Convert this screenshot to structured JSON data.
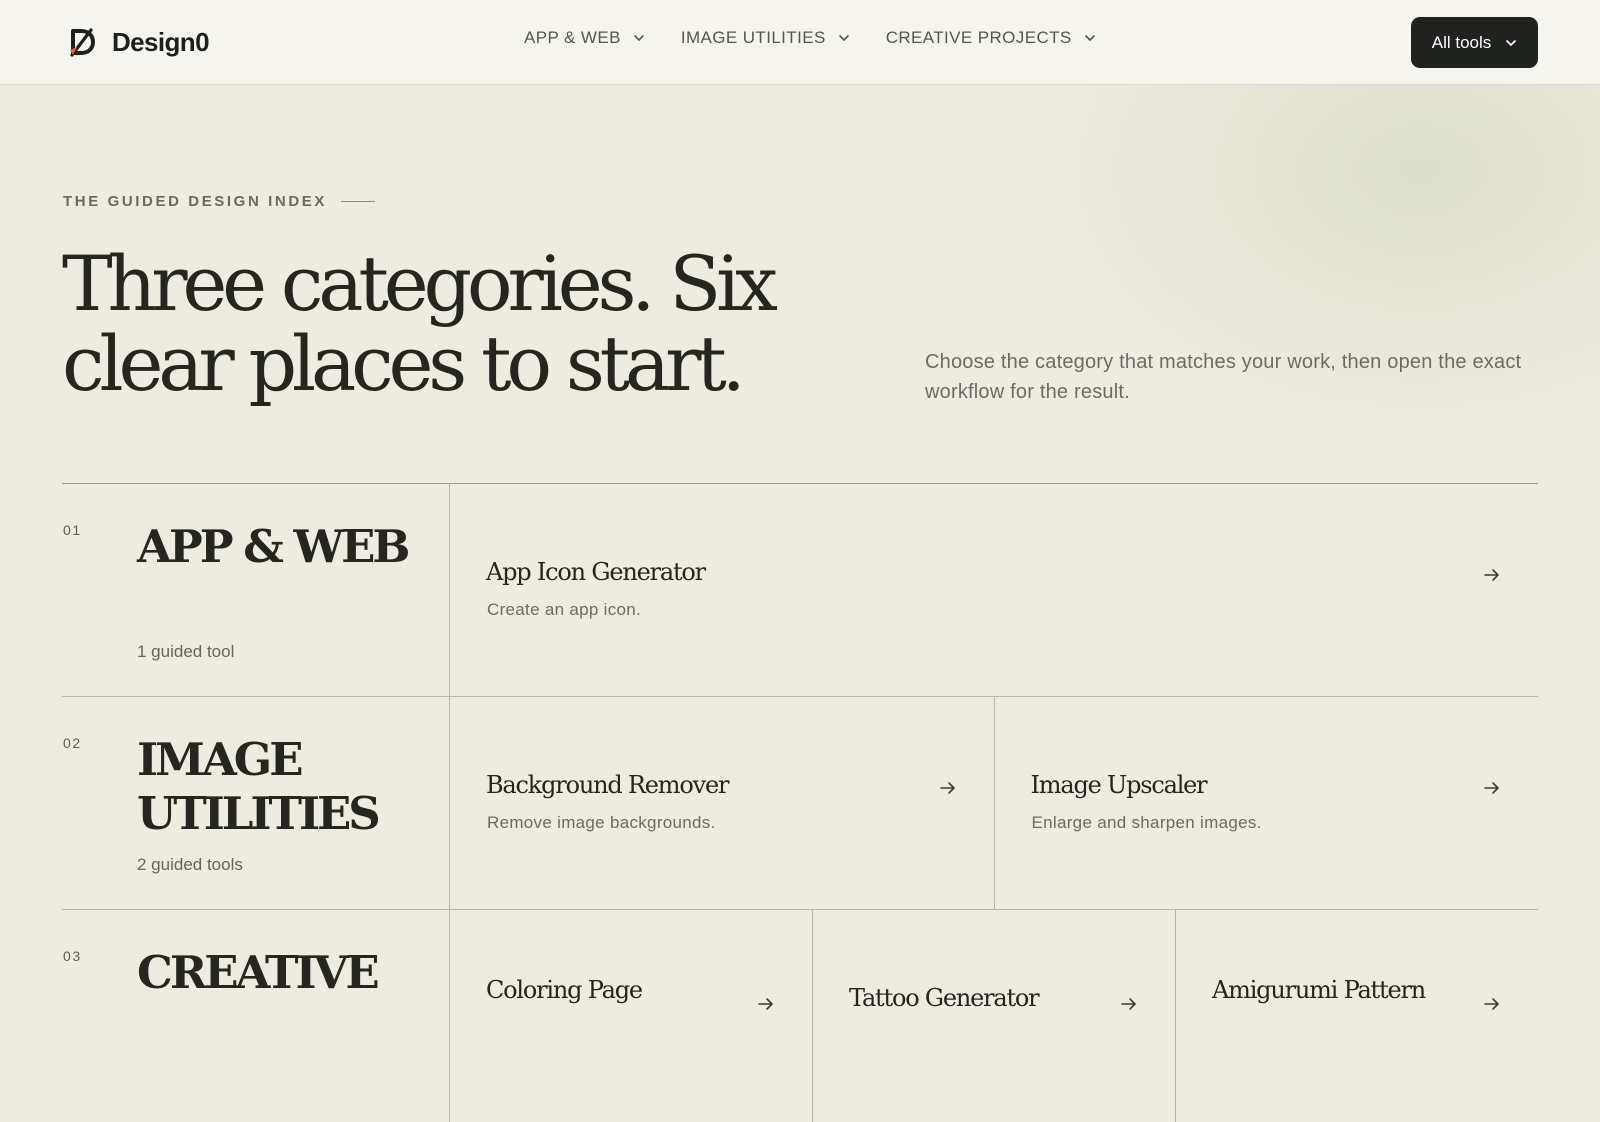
{
  "brand": {
    "name": "Design0",
    "logo_icon": "brand-d-slash-logo"
  },
  "nav": {
    "items": [
      {
        "label": "APP & WEB",
        "icon": "chevron-down-icon"
      },
      {
        "label": "IMAGE UTILITIES",
        "icon": "chevron-down-icon"
      },
      {
        "label": "CREATIVE PROJECTS",
        "icon": "chevron-down-icon"
      }
    ],
    "all_tools_label": "All tools"
  },
  "hero": {
    "eyebrow": "THE GUIDED DESIGN INDEX",
    "headline": "Three categories. Six clear places to start.",
    "intro": "Choose the category that matches your work, then open the exact workflow for the result."
  },
  "categories": [
    {
      "number": "01",
      "name": "APP & WEB",
      "count": "1 guided tool",
      "tools": [
        {
          "name": "App Icon Generator",
          "description": "Create an app icon."
        }
      ]
    },
    {
      "number": "02",
      "name": "IMAGE UTILITIES",
      "count": "2 guided tools",
      "tools": [
        {
          "name": "Background Remover",
          "description": "Remove image backgrounds."
        },
        {
          "name": "Image Upscaler",
          "description": "Enlarge and sharpen images."
        }
      ]
    },
    {
      "number": "03",
      "name": "CREATIVE",
      "count": "",
      "tools": [
        {
          "name": "Coloring Page",
          "description": ""
        },
        {
          "name": "Tattoo Generator",
          "description": ""
        },
        {
          "name": "Amigurumi Pattern",
          "description": ""
        }
      ]
    }
  ],
  "colors": {
    "page_bg": "#eeebe1",
    "header_bg": "#f6f4ee",
    "button_dark": "#1f221f",
    "text_primary": "#25261f",
    "text_muted": "#6b6c66",
    "logo_accent": "#e0633a"
  }
}
